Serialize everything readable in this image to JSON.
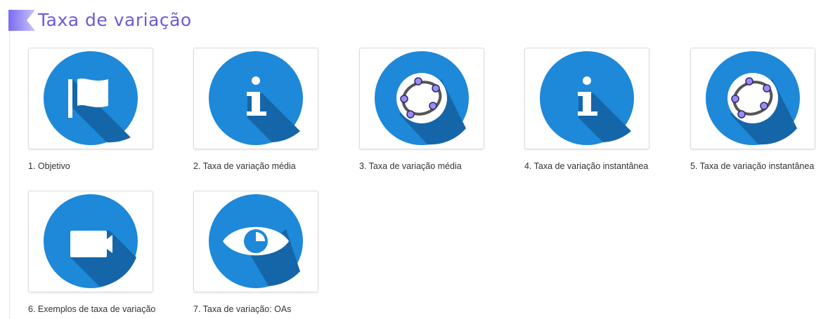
{
  "header": {
    "title": "Taxa de variação",
    "icon": "banner-chevron-icon"
  },
  "colors": {
    "title": "#6b5bd6",
    "circle": "#1e88d9",
    "shadow": "#1566a8"
  },
  "items": [
    {
      "label": "1. Objetivo",
      "icon": "flag-icon"
    },
    {
      "label": "2. Taxa de variação média",
      "icon": "info-icon"
    },
    {
      "label": "3. Taxa de variação média",
      "icon": "geogebra-icon"
    },
    {
      "label": "4. Taxa de variação instantânea",
      "icon": "info-icon"
    },
    {
      "label": "5. Taxa de variação instantânea",
      "icon": "geogebra-icon"
    },
    {
      "label": "6. Exemplos de taxa de variação",
      "icon": "video-camera-icon"
    },
    {
      "label": "7. Taxa de variação: OAs",
      "icon": "eye-icon"
    }
  ]
}
